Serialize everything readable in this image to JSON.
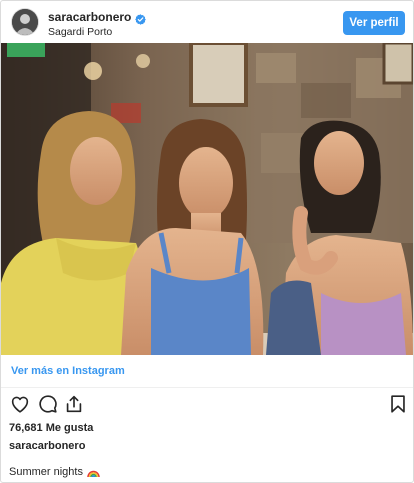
{
  "header": {
    "username": "saracarbonero",
    "location": "Sagardi Porto",
    "profile_button": "Ver perfil"
  },
  "post": {
    "view_more_link": "Ver más en Instagram",
    "likes": "76,681 Me gusta",
    "author": "saracarbonero",
    "caption": "Summer nights"
  },
  "icons": {
    "verified": "verified-badge-icon",
    "like": "heart-icon",
    "comment": "comment-bubble-icon",
    "share": "share-upload-icon",
    "save": "bookmark-icon",
    "emoji": "rainbow-emoji-icon"
  },
  "colors": {
    "accent": "#3897f0",
    "text": "#262626",
    "border": "#dbdbdb"
  }
}
